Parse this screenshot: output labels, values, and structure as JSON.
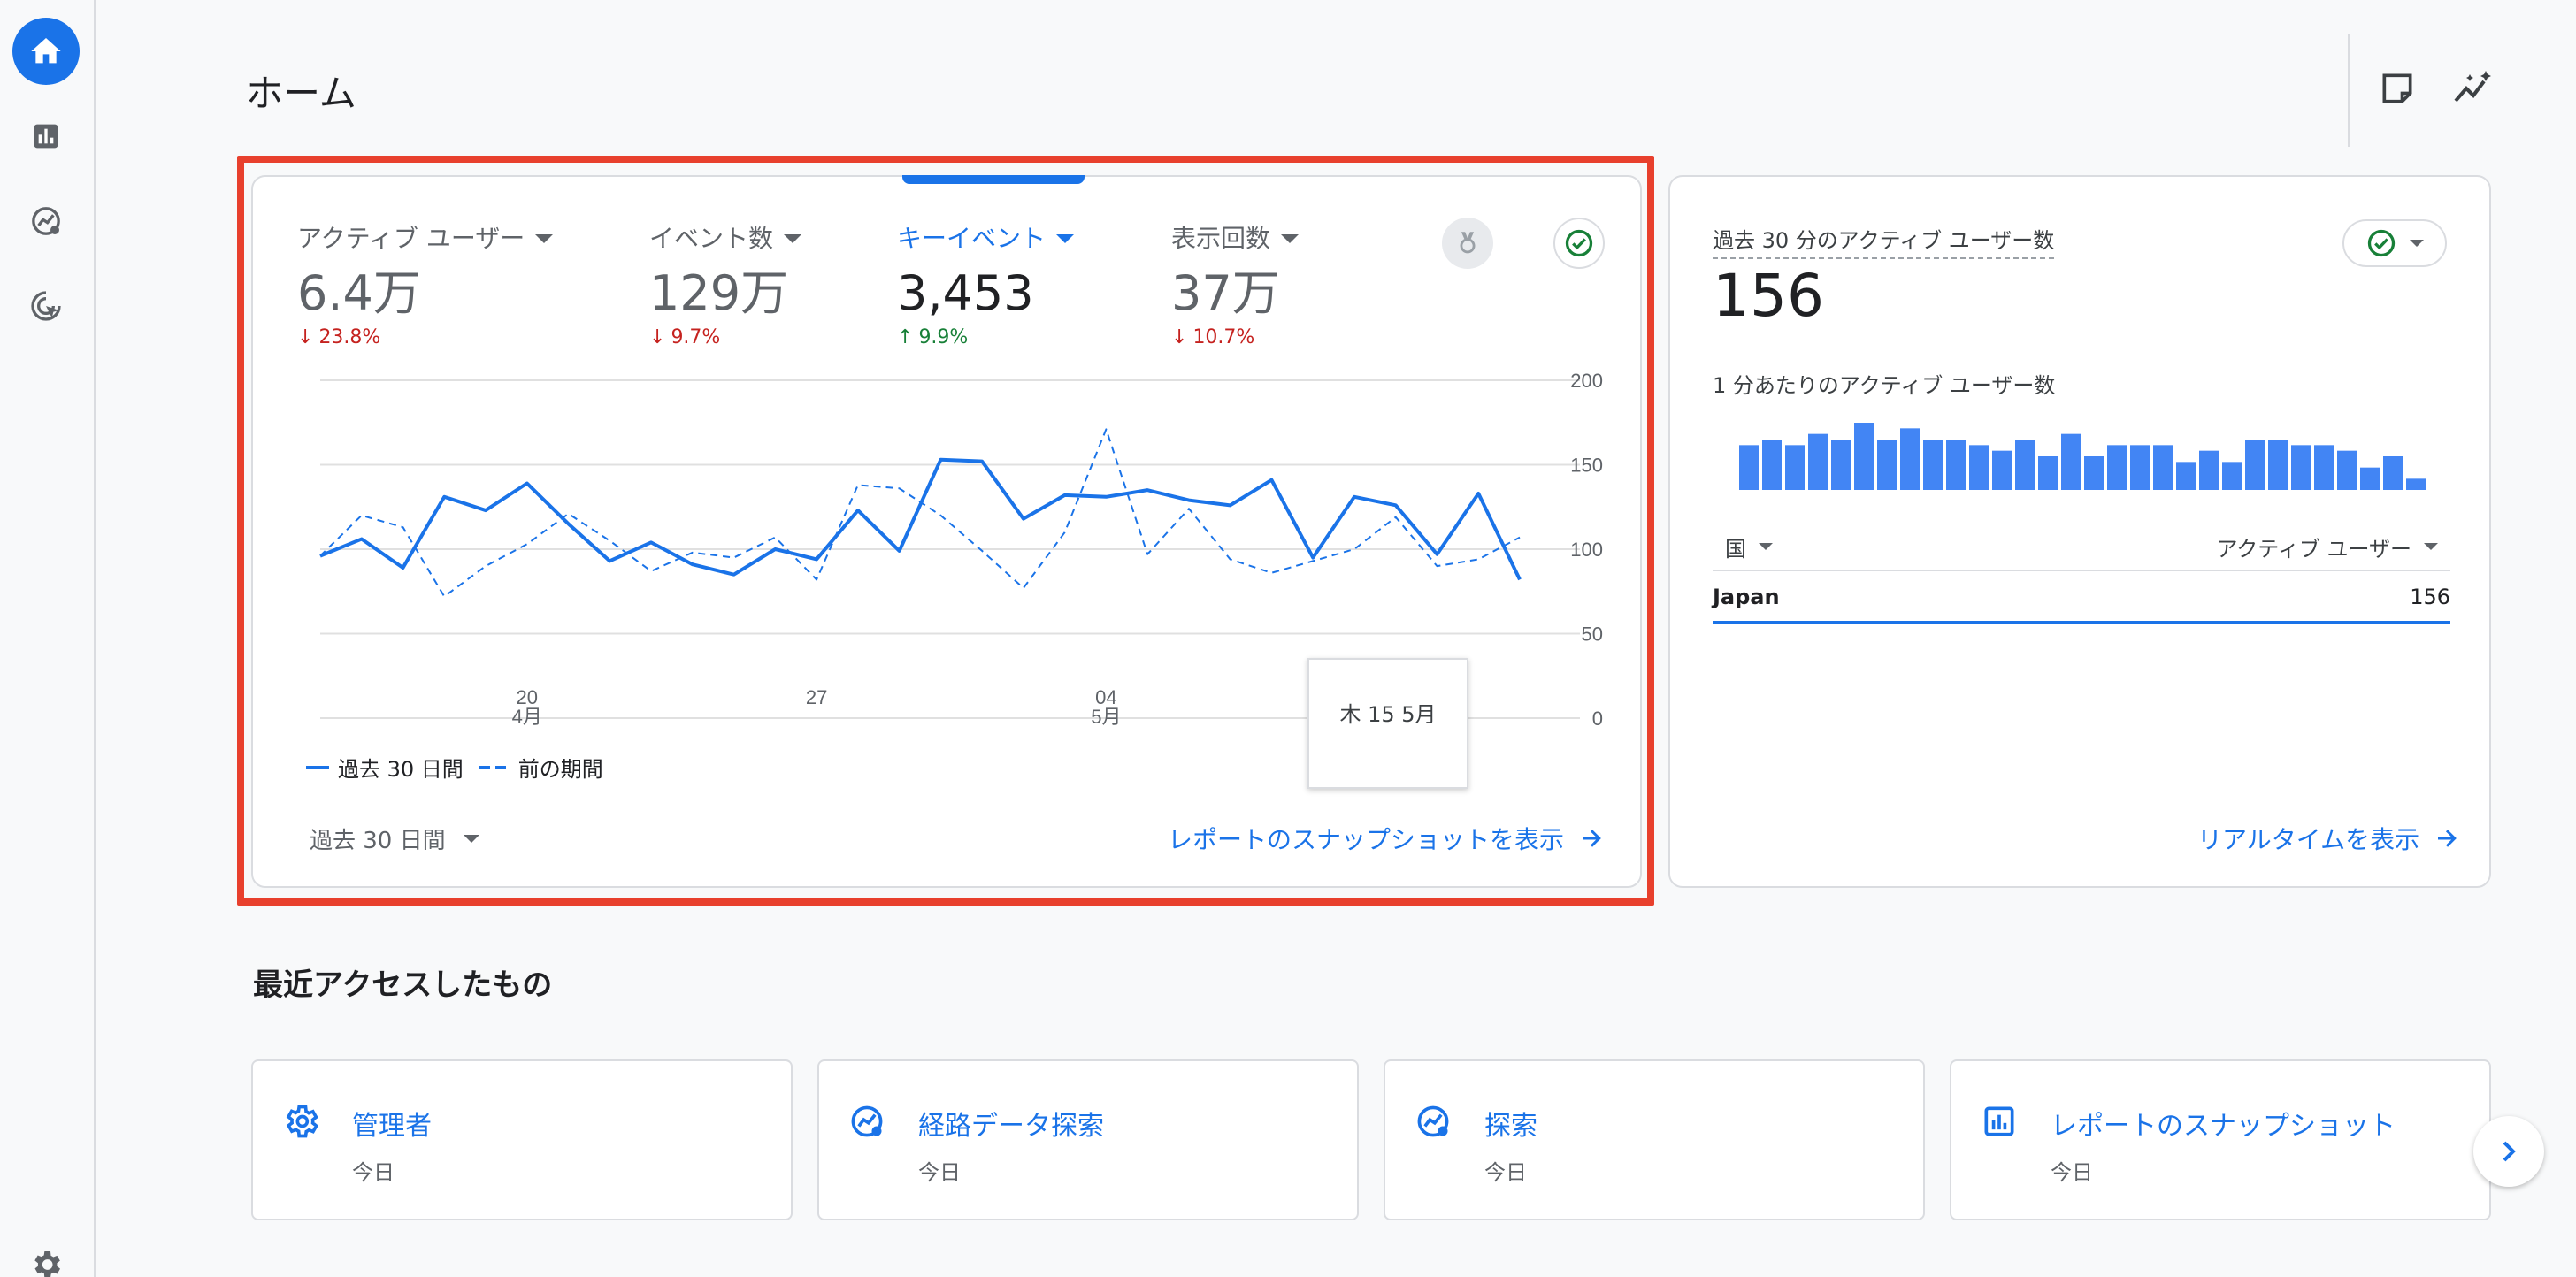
{
  "page": {
    "title": "ホーム"
  },
  "nav": {
    "items": [
      {
        "name": "home",
        "icon": "home-icon"
      },
      {
        "name": "reports",
        "icon": "bar-chart-icon"
      },
      {
        "name": "explore",
        "icon": "explore-icon"
      },
      {
        "name": "advertising",
        "icon": "target-cursor-icon"
      }
    ],
    "settings_icon": "gear-icon"
  },
  "header_icons": [
    "notes-icon",
    "insights-icon"
  ],
  "metrics": [
    {
      "label": "アクティブ ユーザー",
      "value": "6.4万",
      "change": "23.8%",
      "direction": "down",
      "selected": false
    },
    {
      "label": "イベント数",
      "value": "129万",
      "change": "9.7%",
      "direction": "down",
      "selected": false
    },
    {
      "label": "キーイベント",
      "value": "3,453",
      "change": "9.9%",
      "direction": "up",
      "selected": true
    },
    {
      "label": "表示回数",
      "value": "37万",
      "change": "10.7%",
      "direction": "down",
      "selected": false
    }
  ],
  "chart_data": {
    "type": "line",
    "x_tick_labels": [
      {
        "day": "20",
        "month": "4月"
      },
      {
        "day": "27",
        "month": ""
      },
      {
        "day": "04",
        "month": "5月"
      }
    ],
    "y_ticks": [
      200,
      150,
      100,
      50,
      0
    ],
    "ylim": [
      0,
      200
    ],
    "series": [
      {
        "name": "過去 30 日間",
        "style": "solid",
        "values": [
          96,
          106,
          89,
          131,
          123,
          139,
          115,
          93,
          104,
          91,
          85,
          100,
          94,
          123,
          99,
          153,
          152,
          118,
          132,
          131,
          135,
          129,
          126,
          141,
          95,
          131,
          126,
          97,
          133,
          82
        ]
      },
      {
        "name": "前の期間",
        "style": "dashed",
        "values": [
          96,
          120,
          113,
          72,
          90,
          103,
          121,
          105,
          87,
          98,
          95,
          107,
          82,
          138,
          136,
          120,
          99,
          77,
          110,
          171,
          97,
          124,
          94,
          86,
          93,
          100,
          119,
          90,
          94,
          107
        ]
      }
    ],
    "colors": {
      "line": "#1a73e8",
      "grid": "#e0e0e0"
    }
  },
  "tooltip": {
    "text": "木 15 5月"
  },
  "legend": {
    "current": "過去 30 日間",
    "previous": "前の期間"
  },
  "period": {
    "label": "過去 30 日間"
  },
  "snapshot_link": "レポートのスナップショットを表示",
  "realtime": {
    "label": "過去 30 分のアクティブ ユーザー数",
    "value": "156",
    "sub_label": "1 分あたりのアクティブ ユーザー数",
    "per_minute": [
      8,
      9,
      8,
      10,
      9,
      12,
      9,
      11,
      9,
      9,
      8,
      7,
      9,
      6,
      10,
      6,
      8,
      8,
      8,
      5,
      7,
      5,
      9,
      9,
      8,
      8,
      7,
      4,
      6,
      2
    ],
    "table": {
      "col_country": "国",
      "col_users": "アクティブ ユーザー",
      "rows": [
        {
          "country": "Japan",
          "users": "156"
        }
      ]
    },
    "link": "リアルタイムを表示"
  },
  "recent": {
    "title": "最近アクセスしたもの",
    "items": [
      {
        "title": "管理者",
        "date": "今日",
        "icon": "gear-icon"
      },
      {
        "title": "経路データ探索",
        "date": "今日",
        "icon": "path-explore-icon"
      },
      {
        "title": "探索",
        "date": "今日",
        "icon": "explore-icon"
      },
      {
        "title": "レポートのスナップショット",
        "date": "今日",
        "icon": "report-icon"
      }
    ]
  },
  "colors": {
    "accent": "#1a73e8",
    "down": "#c5221f",
    "up": "#188038",
    "highlight": "#e8402d"
  }
}
